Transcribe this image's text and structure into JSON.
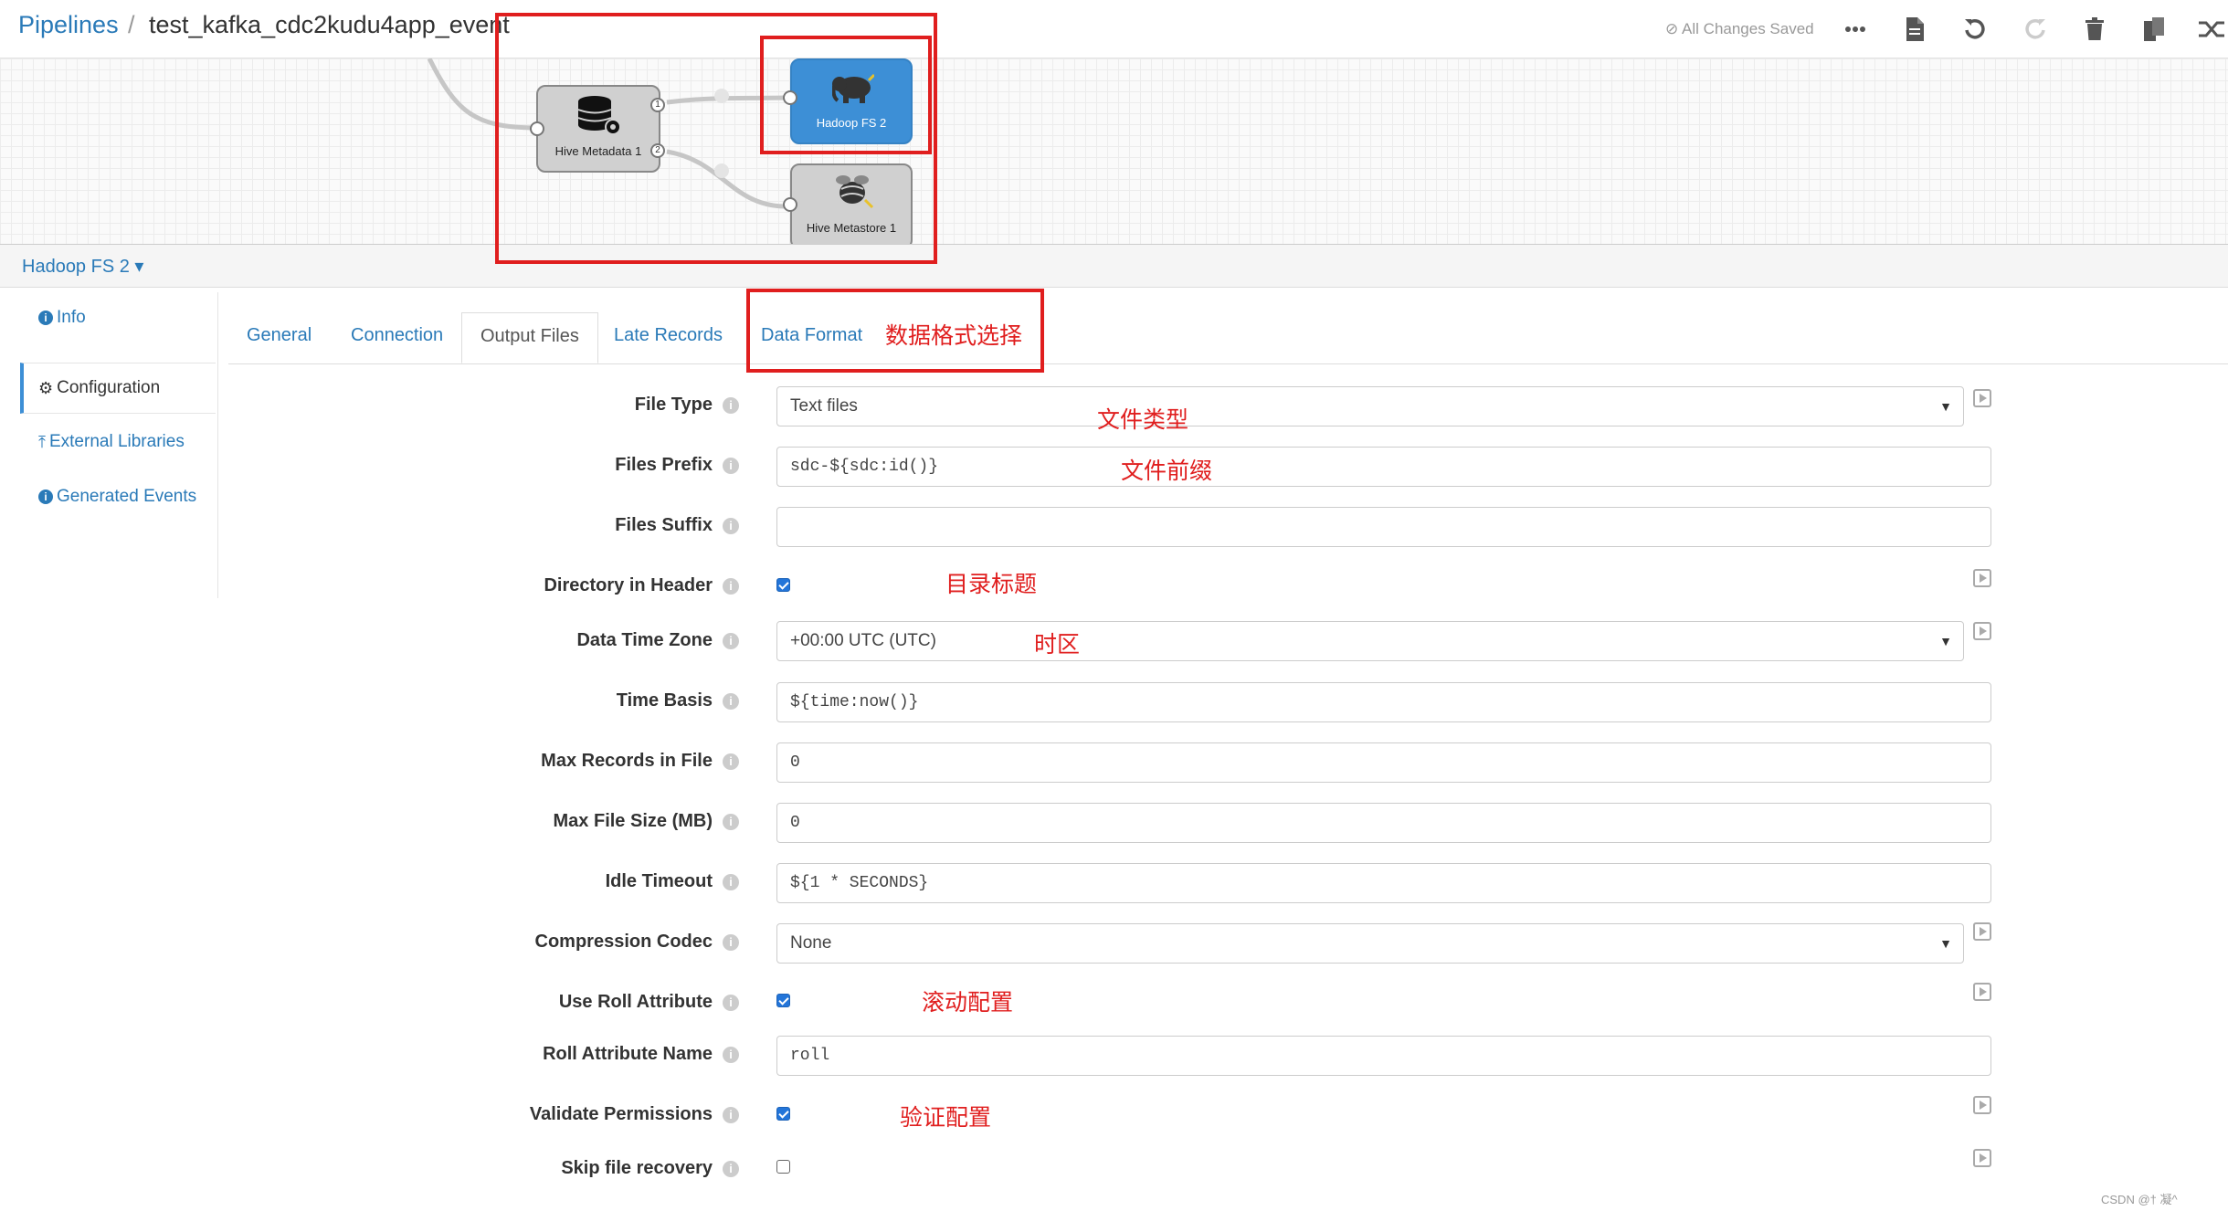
{
  "header": {
    "breadcrumb_root": "Pipelines",
    "breadcrumb_sep": "/",
    "pipeline_name": "test_kafka_cdc2kudu4app_event",
    "status_text": "All Changes Saved"
  },
  "canvas": {
    "nodes": {
      "hive_metadata": "Hive Metadata 1",
      "hadoop_fs": "Hadoop FS 2",
      "hive_metastore": "Hive Metastore 1"
    },
    "ports": {
      "one": "1",
      "two": "2"
    }
  },
  "stage": {
    "title": "Hadoop FS 2 ▾"
  },
  "sidebar": {
    "items": [
      {
        "label": "Info",
        "icon": "info-circle-icon"
      },
      {
        "label": "Configuration",
        "icon": "gear-icon"
      },
      {
        "label": "External Libraries",
        "icon": "upload-icon"
      },
      {
        "label": "Generated Events",
        "icon": "info-circle-icon"
      }
    ]
  },
  "tabs": [
    "General",
    "Connection",
    "Output Files",
    "Late Records",
    "Data Format"
  ],
  "form": {
    "file_type": {
      "label": "File Type",
      "value": "Text files"
    },
    "files_prefix": {
      "label": "Files Prefix",
      "value": "sdc-${sdc:id()}"
    },
    "files_suffix": {
      "label": "Files Suffix",
      "value": ""
    },
    "dir_in_header": {
      "label": "Directory in Header",
      "checked": true
    },
    "data_time_zone": {
      "label": "Data Time Zone",
      "value": "+00:00 UTC (UTC)"
    },
    "time_basis": {
      "label": "Time Basis",
      "value": "${time:now()}"
    },
    "max_records": {
      "label": "Max Records in File",
      "value": "0"
    },
    "max_file_size": {
      "label": "Max File Size (MB)",
      "value": "0"
    },
    "idle_timeout": {
      "label": "Idle Timeout",
      "value": "${1 * SECONDS}"
    },
    "compression_codec": {
      "label": "Compression Codec",
      "value": "None"
    },
    "use_roll_attr": {
      "label": "Use Roll Attribute",
      "checked": true
    },
    "roll_attr_name": {
      "label": "Roll Attribute Name",
      "value": "roll"
    },
    "validate_perms": {
      "label": "Validate Permissions",
      "checked": true
    },
    "skip_recovery": {
      "label": "Skip file recovery",
      "checked": false
    }
  },
  "annotations": {
    "data_format": "数据格式选择",
    "file_type": "文件类型",
    "files_prefix": "文件前缀",
    "dir_header": "目录标题",
    "time_zone": "时区",
    "roll": "滚动配置",
    "validate": "验证配置"
  },
  "colors": {
    "accent": "#2a7ab8",
    "active_node": "#3d8fd6",
    "annotation": "#e01e1e",
    "checkbox": "#2375d9"
  },
  "watermark": "CSDN @† 凝^"
}
